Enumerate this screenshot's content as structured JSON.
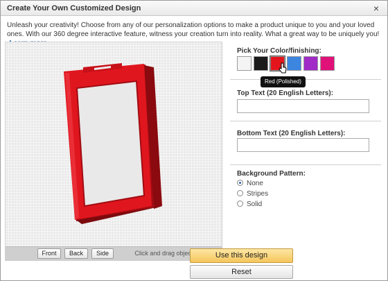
{
  "dialog": {
    "title": "Create Your Own Customized Design",
    "close_label": "×"
  },
  "intro": {
    "text": "Unleash your creativity! Choose from any of our personalization options to make a product unique to you and your loved ones. With our 360 degree interactive feature, witness your creation turn into reality. What a great way to be uniquely you!",
    "arrow": "▸",
    "learn_more": "Learn more"
  },
  "viewer": {
    "product_color": "#e0161e",
    "buttons": [
      "Front",
      "Back",
      "Side"
    ],
    "hint": "Click and drag object to rotate"
  },
  "color": {
    "label": "Pick Your Color/finishing:",
    "swatches": [
      {
        "name": "white",
        "color": "#f4f4f4"
      },
      {
        "name": "black",
        "color": "#1b1b1b"
      },
      {
        "name": "red",
        "color": "#e3141c"
      },
      {
        "name": "blue",
        "color": "#3c86e0"
      },
      {
        "name": "purple",
        "color": "#a02bc7"
      },
      {
        "name": "pink",
        "color": "#e0127a"
      }
    ],
    "selected_index": 2,
    "tooltip": "Red (Polished)"
  },
  "top_text": {
    "label": "Top Text (20 English Letters):",
    "value": ""
  },
  "bottom_text": {
    "label": "Bottom Text (20 English Letters):",
    "value": ""
  },
  "background": {
    "label": "Background Pattern:",
    "options": [
      "None",
      "Stripes",
      "Solid"
    ],
    "selected_index": 0
  },
  "actions": {
    "use_label": "Use this design",
    "reset_label": "Reset"
  }
}
